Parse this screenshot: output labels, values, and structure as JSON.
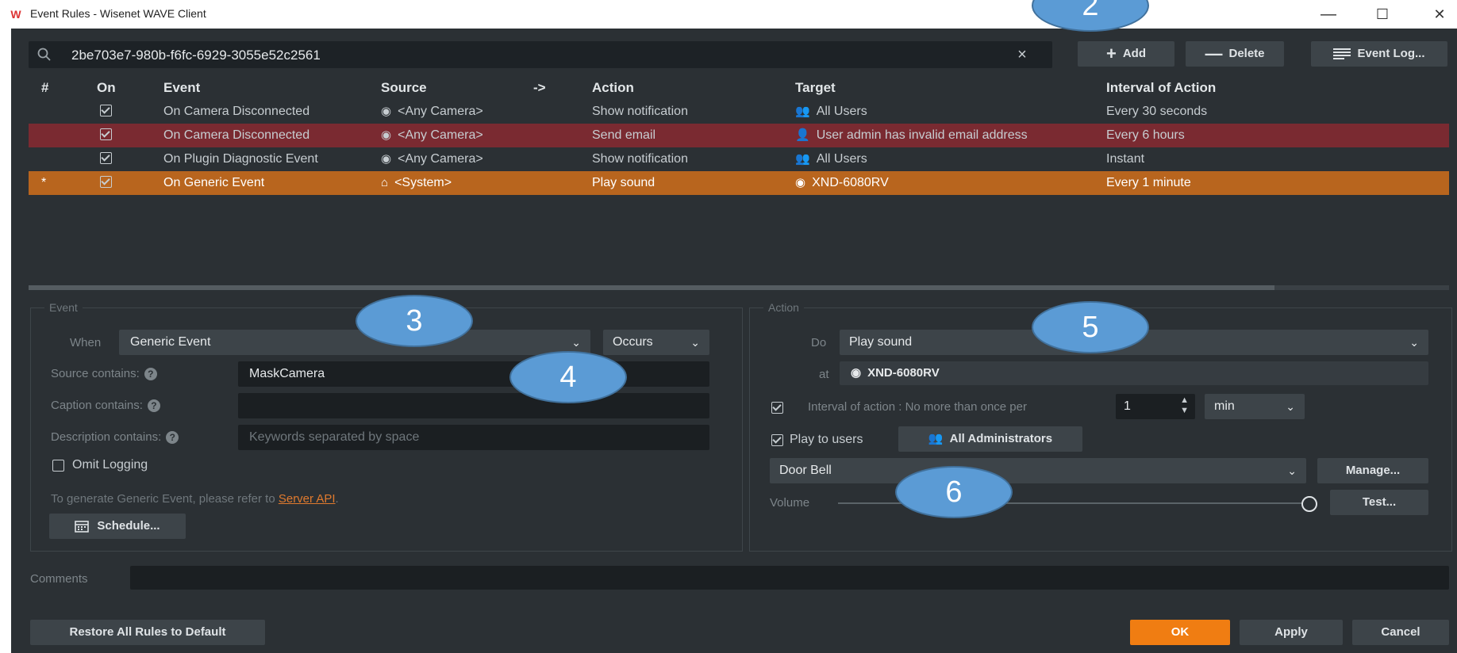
{
  "window": {
    "title": "Event Rules - Wisenet WAVE Client",
    "logo": "W",
    "minimize": "—",
    "maximize": "☐",
    "close": "✕"
  },
  "search": {
    "value": "2be703e7-980b-f6fc-6929-3055e52c2561",
    "clear": "×"
  },
  "toolbar": {
    "add_icon": "+",
    "add_label": "Add",
    "delete_icon": "—",
    "delete_label": "Delete",
    "eventlog_label": "Event Log..."
  },
  "table": {
    "headers": {
      "num": "#",
      "on": "On",
      "event": "Event",
      "source": "Source",
      "arrow": "->",
      "action": "Action",
      "target": "Target",
      "interval": "Interval of Action"
    },
    "rows": [
      {
        "num": "",
        "event": "On Camera Disconnected",
        "source": "<Any Camera>",
        "action": "Show notification",
        "target": "All Users",
        "interval": "Every 30 seconds"
      },
      {
        "num": "",
        "event": "On Camera Disconnected",
        "source": "<Any Camera>",
        "action": "Send email",
        "target": "User admin has invalid email address",
        "interval": "Every 6 hours"
      },
      {
        "num": "",
        "event": "On Plugin Diagnostic Event",
        "source": "<Any Camera>",
        "action": "Show notification",
        "target": "All Users",
        "interval": "Instant"
      },
      {
        "num": "*",
        "event": "On Generic Event",
        "source": "<System>",
        "action": "Play sound",
        "target": "XND-6080RV",
        "interval": "Every 1 minute"
      }
    ]
  },
  "event_panel": {
    "title": "Event",
    "when_label": "When",
    "when_value": "Generic Event",
    "occurs_value": "Occurs",
    "source_label": "Source contains:",
    "source_value": "MaskCamera",
    "caption_label": "Caption contains:",
    "caption_value": "",
    "description_label": "Description contains:",
    "description_placeholder": "Keywords separated by space",
    "omit_logging_label": "Omit Logging",
    "hint_text": "To generate Generic Event, please refer to",
    "hint_link": "Server API",
    "hint_end": ".",
    "schedule_label": "Schedule..."
  },
  "action_panel": {
    "title": "Action",
    "do_label": "Do",
    "do_value": "Play sound",
    "at_label": "at",
    "at_value": "XND-6080RV",
    "interval_label": "Interval of action :  No more than once per",
    "interval_value": "1",
    "interval_unit": "min",
    "play_to_users_label": "Play to users",
    "users_button": "All Administrators",
    "sound_value": "Door Bell",
    "manage_label": "Manage...",
    "volume_label": "Volume",
    "volume_level": 1.0,
    "test_label": "Test..."
  },
  "comments": {
    "label": "Comments",
    "value": ""
  },
  "footer": {
    "restore_label": "Restore All Rules to Default",
    "ok_label": "OK",
    "apply_label": "Apply",
    "cancel_label": "Cancel"
  },
  "callouts": {
    "c2": "2",
    "c3": "3",
    "c4": "4",
    "c5": "5",
    "c6": "6"
  },
  "colors": {
    "bg": "#2b3034",
    "error_row": "#7a2a31",
    "selected_row": "#b8651e",
    "ok_button": "#f07d12",
    "link": "#e07a2e",
    "callout": "#5b9bd5"
  }
}
